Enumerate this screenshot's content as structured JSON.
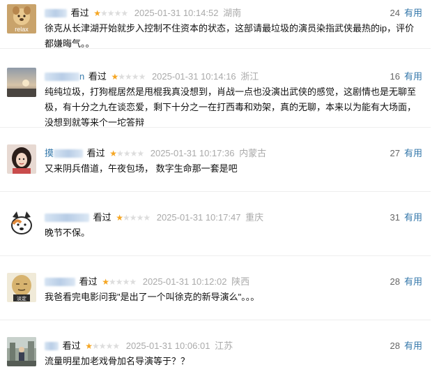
{
  "ui": {
    "watched_label": "看过",
    "useful_label": "有用",
    "star_on": "★",
    "star_off": "★"
  },
  "comments": [
    {
      "user_visible": "",
      "rating": 1,
      "time": "2025-01-31 10:14:52",
      "location": "湖南",
      "votes": "24",
      "text": "徐克从长津湖开始就步入控制不住资本的状态，这部请最垃圾的演员染指武侠最热的ip，评价都嫌晦气。。",
      "avatar": "relax-dog-avatar",
      "avatar_text": "relax"
    },
    {
      "user_visible": "n",
      "rating": 1,
      "time": "2025-01-31 10:14:16",
      "location": "浙江",
      "votes": "16",
      "text": "纯纯垃圾，打狗棍居然是甩棍我真没想到，肖战一点也没演出武侠的感觉，这剧情也是无聊至极，有十分之九在谈恋爱，剩下十分之一在打西毒和劝架，真的无聊，本来以为能有大场面，没想到就等来个一坨答辩",
      "avatar": "sunset-avatar",
      "avatar_text": ""
    },
    {
      "user_visible": "摸",
      "rating": 1,
      "time": "2025-01-31 10:17:36",
      "location": "内蒙古",
      "votes": "27",
      "text": "又来阴兵借道，午夜包场， 数字生命那一套是吧",
      "avatar": "girl-avatar",
      "avatar_text": ""
    },
    {
      "user_visible": "",
      "rating": 1,
      "time": "2025-01-31 10:17:47",
      "location": "重庆",
      "votes": "31",
      "text": "晚节不保。",
      "avatar": "cartoon-dog-avatar",
      "avatar_text": ""
    },
    {
      "user_visible": "",
      "rating": 1,
      "time": "2025-01-31 10:12:02",
      "location": "陕西",
      "votes": "28",
      "text": "我爸看完电影问我\"是出了一个叫徐克的新导演么\"。。。",
      "avatar": "meme-face-avatar",
      "avatar_text": "淡定"
    },
    {
      "user_visible": "",
      "rating": 1,
      "time": "2025-01-31 10:06:01",
      "location": "江苏",
      "votes": "28",
      "text": "流量明星加老戏骨加名导演等于？？",
      "avatar": "street-photo-avatar",
      "avatar_text": ""
    }
  ]
}
